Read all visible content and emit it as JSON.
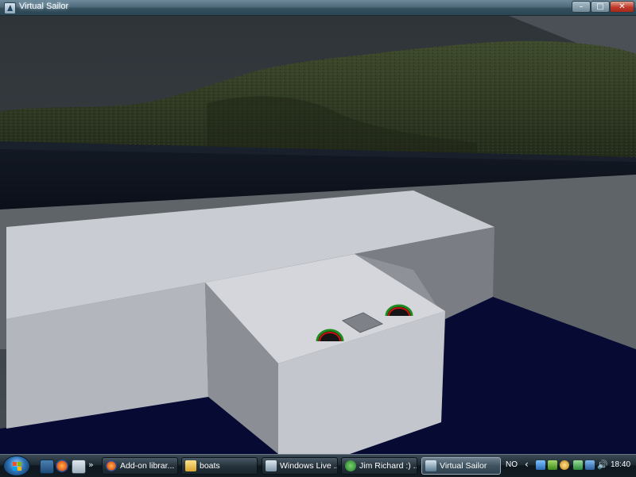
{
  "window": {
    "title": "Virtual Sailor",
    "min_glyph": "–",
    "max_glyph": "□",
    "close_glyph": "✕",
    "icon": "virtual-sailor-app-icon"
  },
  "scene": {
    "description_colors": {
      "sky": "#3b4147",
      "hills": "#2f3a22",
      "water": "#0b1020",
      "deck": "#c9ccd2",
      "cabin_top": "#d6d8dd"
    }
  },
  "taskbar": {
    "quick_launch_more": "»",
    "tasks": [
      {
        "label": "Add-on librar...",
        "icon": "firefox-icon"
      },
      {
        "label": "boats",
        "icon": "folder-icon"
      },
      {
        "label": "Windows Live ...",
        "icon": "windows-live-icon"
      },
      {
        "label": "Jim Richard :) ...",
        "icon": "messenger-icon"
      },
      {
        "label": "Virtual Sailor",
        "icon": "virtual-sailor-icon",
        "active": true
      }
    ],
    "language": "NO",
    "tray_chevron": "‹",
    "volume_glyph": "🔊",
    "clock": "18:40"
  }
}
